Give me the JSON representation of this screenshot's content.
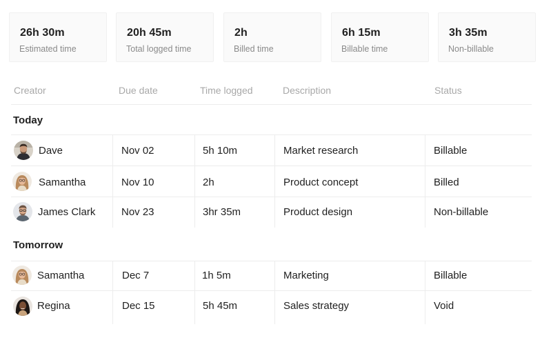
{
  "stats": [
    {
      "value": "26h 30m",
      "label": "Estimated time"
    },
    {
      "value": "20h 45m",
      "label": "Total logged time"
    },
    {
      "value": "2h",
      "label": "Billed time"
    },
    {
      "value": "6h 15m",
      "label": "Billable time"
    },
    {
      "value": "3h 35m",
      "label": "Non-billable"
    }
  ],
  "table": {
    "columns": {
      "creator": "Creator",
      "due_date": "Due date",
      "time_logged": "Time logged",
      "description": "Description",
      "status": "Status"
    },
    "groups": [
      {
        "title": "Today",
        "rows": [
          {
            "creator": "Dave",
            "avatar": "avatar-dave",
            "due_date": "Nov 02",
            "time_logged": "5h 10m",
            "description": "Market research",
            "status": "Billable"
          },
          {
            "creator": "Samantha",
            "avatar": "avatar-samantha",
            "due_date": "Nov 10",
            "time_logged": "2h",
            "description": "Product concept",
            "status": "Billed"
          },
          {
            "creator": "James Clark",
            "avatar": "avatar-james",
            "due_date": "Nov 23",
            "time_logged": "3hr 35m",
            "description": "Product design",
            "status": "Non-billable"
          }
        ]
      },
      {
        "title": "Tomorrow",
        "rows": [
          {
            "creator": "Samantha",
            "avatar": "avatar-samantha",
            "due_date": "Dec 7",
            "time_logged": "1h 5m",
            "description": "Marketing",
            "status": "Billable"
          },
          {
            "creator": "Regina",
            "avatar": "avatar-regina",
            "due_date": "Dec 15",
            "time_logged": "5h 45m",
            "description": "Sales strategy",
            "status": "Void"
          }
        ]
      }
    ]
  }
}
